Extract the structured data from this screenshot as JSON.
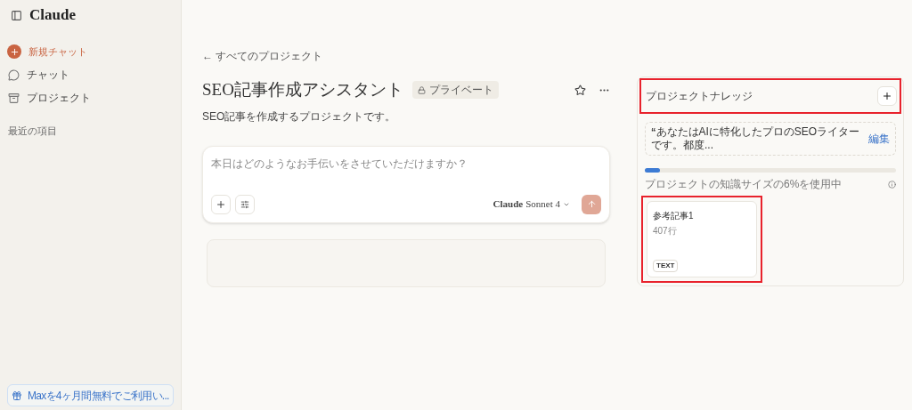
{
  "sidebar": {
    "logo": "Claude",
    "new_chat": "新規チャット",
    "items": [
      {
        "label": "チャット",
        "kind": "chat"
      },
      {
        "label": "プロジェクト",
        "kind": "project"
      }
    ],
    "recent_heading": "最近の項目",
    "promo": "Maxを4ヶ月間無料でご利用い..."
  },
  "back_link": "← すべてのプロジェクト",
  "project": {
    "title": "SEO記事作成アシスタント",
    "badge": "プライベート",
    "description": "SEO記事を作成するプロジェクトです。",
    "starred": false
  },
  "composer": {
    "placeholder": "本日はどのようなお手伝いをさせていただけますか？",
    "model_brand": "Claude",
    "model_name": "Sonnet 4"
  },
  "knowledge": {
    "title": "プロジェクトナレッジ",
    "highlighted": true,
    "instructions": "あなたはAIに特化したプロのSEOライターです。都度...",
    "quote_mark": "“",
    "edit": "編集",
    "level": 0.06,
    "usage": "プロジェクトの知識サイズの6%を使用中",
    "files": [
      {
        "name": "参考記事1",
        "lines": "407行",
        "type": "TEXT",
        "highlighted": true
      }
    ]
  }
}
